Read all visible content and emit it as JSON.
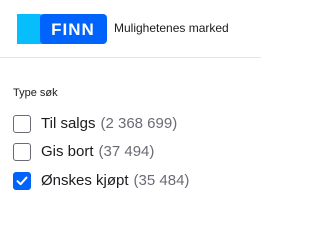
{
  "header": {
    "logo_text": "FINN",
    "logo_icon": "finn-logo-icon",
    "tagline": "Mulighetenes marked"
  },
  "colors": {
    "brand_blue": "#0063fb",
    "brand_light_blue": "#06befb",
    "text": "#1b1b1f",
    "muted": "#6b6b75"
  },
  "filter": {
    "title": "Type søk",
    "options": [
      {
        "label": "Til salgs",
        "count": "(2 368 699)",
        "checked": false
      },
      {
        "label": "Gis bort",
        "count": "(37 494)",
        "checked": false
      },
      {
        "label": "Ønskes kjøpt",
        "count": "(35 484)",
        "checked": true
      }
    ]
  }
}
